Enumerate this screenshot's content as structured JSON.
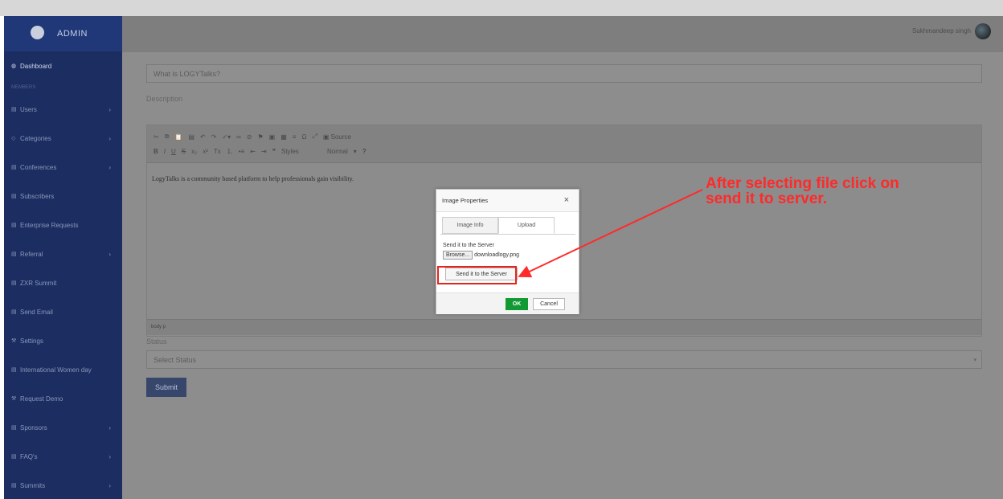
{
  "brand": {
    "name": "ADMIN"
  },
  "sidebar": {
    "section_label": "MEMBERS",
    "items": [
      {
        "icon": "dashboard-icon",
        "label": "Dashboard",
        "chevron": false,
        "active": true
      },
      {
        "icon": "users-icon",
        "label": "Users",
        "chevron": true
      },
      {
        "icon": "tag-icon",
        "label": "Categories",
        "chevron": true
      },
      {
        "icon": "list-icon",
        "label": "Conferences",
        "chevron": true
      },
      {
        "icon": "list-icon",
        "label": "Subscribers",
        "chevron": false
      },
      {
        "icon": "list-icon",
        "label": "Enterprise Requests",
        "chevron": false
      },
      {
        "icon": "list-icon",
        "label": "Referral",
        "chevron": true
      },
      {
        "icon": "list-icon",
        "label": "ZXR Summit",
        "chevron": false
      },
      {
        "icon": "list-icon",
        "label": "Send Email",
        "chevron": false
      },
      {
        "icon": "wrench-icon",
        "label": "Settings",
        "chevron": false
      },
      {
        "icon": "list-icon",
        "label": "International Women day",
        "chevron": false
      },
      {
        "icon": "wrench-icon",
        "label": "Request Demo",
        "chevron": false
      },
      {
        "icon": "list-icon",
        "label": "Sponsors",
        "chevron": true
      },
      {
        "icon": "list-icon",
        "label": "FAQ's",
        "chevron": true
      },
      {
        "icon": "list-icon",
        "label": "Summits",
        "chevron": true
      }
    ]
  },
  "topbar": {
    "user_name": "Sukhmandeep singh"
  },
  "form": {
    "title_value": "What is LOGYTalks?",
    "description_label": "Description",
    "editor_text": "LogyTalks is a community based platform to help professionals gain visibility.",
    "editor_path": "body  p",
    "toolbar_source": "Source",
    "toolbar_styles": "Styles",
    "toolbar_format": "Normal",
    "status_label": "Status",
    "status_placeholder": "Select Status",
    "submit_label": "Submit"
  },
  "dialog": {
    "title": "Image Properties",
    "tabs": [
      "Image Info",
      "Upload"
    ],
    "active_tab": "Upload",
    "send_label": "Send it to the Server",
    "browse_label": "Browse...",
    "file_name": "downloadlogy.png",
    "send_button": "Send it to the Server",
    "ok_label": "OK",
    "cancel_label": "Cancel"
  },
  "annotation": {
    "line1": "After selecting file click on",
    "line2": "send it to server.",
    "color": "#ff2a2a"
  }
}
